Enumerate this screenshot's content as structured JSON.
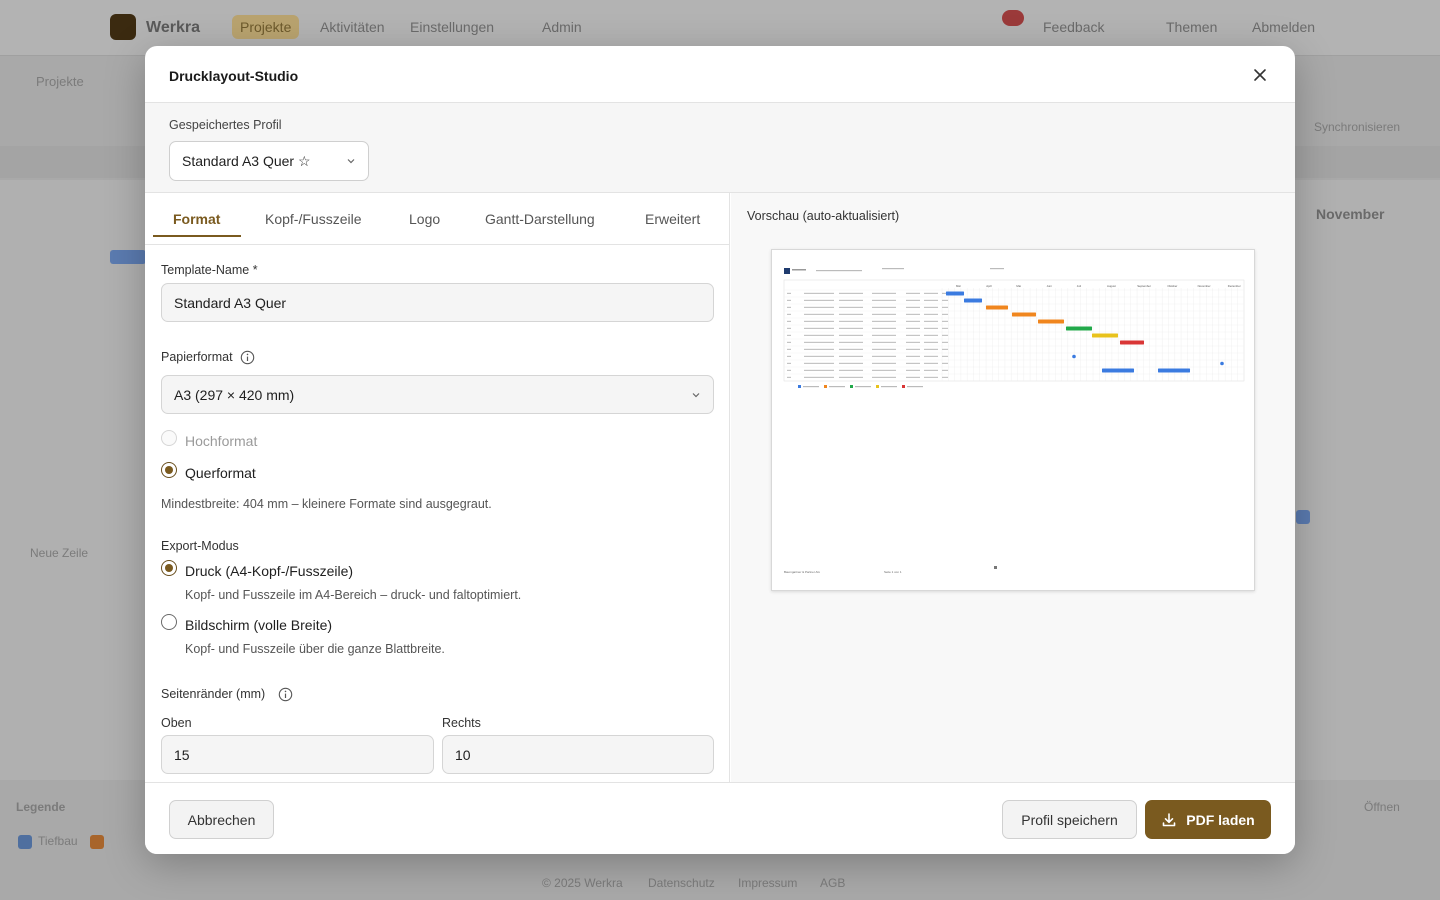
{
  "background": {
    "brand": "Werkra",
    "nav": [
      "Projekte",
      "Aktivitäten",
      "Einstellungen",
      "Admin"
    ],
    "top_right": [
      "Feedback",
      "Themen",
      "Abmelden"
    ],
    "crumb": "Projekte",
    "toolbar_right": "Synchronisieren",
    "month_right": "November",
    "footer_text": "© 2025 Werkra",
    "footer_links": [
      "Datenschutz",
      "Impressum",
      "AGB"
    ],
    "add_row": "Neue Zeile",
    "legend_label": "Legende",
    "legend_item": "Tiefbau",
    "button_right": "Öffnen"
  },
  "modal": {
    "title": "Drucklayout-Studio",
    "close_icon": "close-icon"
  },
  "profile": {
    "label": "Gespeichertes Profil",
    "selected": "Standard A3 Quer ☆"
  },
  "tabs": [
    {
      "label": "Format",
      "active": true
    },
    {
      "label": "Kopf-/Fusszeile",
      "active": false
    },
    {
      "label": "Logo",
      "active": false
    },
    {
      "label": "Gantt-Darstellung",
      "active": false
    },
    {
      "label": "Erweitert",
      "active": false
    }
  ],
  "form": {
    "template_name_label": "Template-Name *",
    "template_name_value": "Standard A3 Quer",
    "paper_label": "Papierformat",
    "paper_value": "A3 (297 × 420 mm)",
    "orientation_portrait": "Hochformat",
    "orientation_landscape": "Querformat",
    "orientation_hint": "Mindestbreite: 404 mm – kleinere Formate sind ausgegraut.",
    "export_label": "Export-Modus",
    "export_print": "Druck (A4-Kopf-/Fusszeile)",
    "export_print_hint": "Kopf- und Fusszeile im A4-Bereich – druck- und faltoptimiert.",
    "export_screen": "Bildschirm (volle Breite)",
    "export_screen_hint": "Kopf- und Fusszeile über die ganze Blattbreite.",
    "margins_label": "Seitenränder (mm)",
    "margin_top_label": "Oben",
    "margin_top_value": "15",
    "margin_right_label": "Rechts",
    "margin_right_value": "10"
  },
  "preview": {
    "title": "Vorschau (auto-aktualisiert)",
    "months": [
      "Mär",
      "April",
      "Mai",
      "Juni",
      "Juli",
      "August",
      "September",
      "Oktober",
      "November",
      "Dezember"
    ],
    "bar_colors": [
      "#3b7be0",
      "#3b7be0",
      "#f0861e",
      "#f0861e",
      "#f0861e",
      "#22a94a",
      "#e8c21c",
      "#d93636",
      "#3b7be0",
      "#3b7be0"
    ],
    "footer_left": "Baumgartner & Partner AG",
    "footer_mid": "Seite 1 von 1"
  },
  "footer": {
    "cancel": "Abbrechen",
    "save_profile": "Profil speichern",
    "pdf": "PDF laden"
  }
}
